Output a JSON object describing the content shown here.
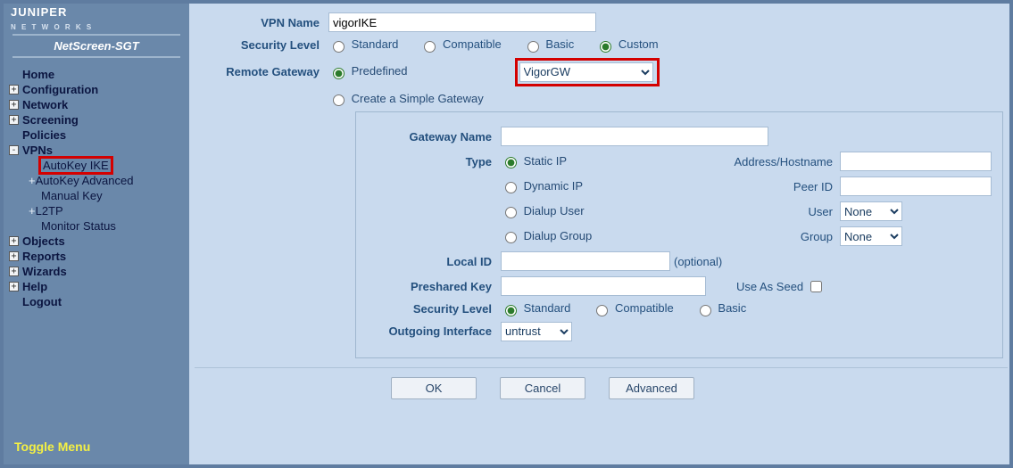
{
  "device": "NetScreen-SGT",
  "logo_top": "JUNIPER",
  "logo_sub": "N E T W O R K S",
  "nav": {
    "home": "Home",
    "configuration": "Configuration",
    "network": "Network",
    "screening": "Screening",
    "policies": "Policies",
    "vpns": "VPNs",
    "vpn_children": {
      "autokey_ike": "AutoKey IKE",
      "autokey_adv": "AutoKey Advanced",
      "manual_key": "Manual Key",
      "l2tp": "L2TP",
      "monitor_status": "Monitor Status"
    },
    "objects": "Objects",
    "reports": "Reports",
    "wizards": "Wizards",
    "help": "Help",
    "logout": "Logout"
  },
  "toggle_menu": "Toggle Menu",
  "form": {
    "vpn_name_lbl": "VPN Name",
    "vpn_name_val": "vigorIKE",
    "sec_level_lbl": "Security Level",
    "sec_levels": {
      "standard": "Standard",
      "compatible": "Compatible",
      "basic": "Basic",
      "custom": "Custom"
    },
    "remote_gw_lbl": "Remote Gateway",
    "rg_predefined": "Predefined",
    "rg_create": "Create a Simple Gateway",
    "rg_select_val": "VigorGW",
    "simple": {
      "gw_name_lbl": "Gateway Name",
      "gw_name_val": "",
      "type_lbl": "Type",
      "types": {
        "static": "Static IP",
        "dynamic": "Dynamic IP",
        "dialup_user": "Dialup User",
        "dialup_group": "Dialup Group"
      },
      "addr_lbl": "Address/Hostname",
      "addr_val": "",
      "peerid_lbl": "Peer ID",
      "peerid_val": "",
      "user_lbl": "User",
      "user_val": "None",
      "group_lbl": "Group",
      "group_val": "None",
      "localid_lbl": "Local ID",
      "localid_val": "",
      "localid_note": "(optional)",
      "psk_lbl": "Preshared Key",
      "psk_val": "",
      "seed_lbl": "Use As Seed",
      "sec_lbl": "Security Level",
      "out_if_lbl": "Outgoing Interface",
      "out_if_val": "untrust"
    },
    "buttons": {
      "ok": "OK",
      "cancel": "Cancel",
      "advanced": "Advanced"
    }
  }
}
